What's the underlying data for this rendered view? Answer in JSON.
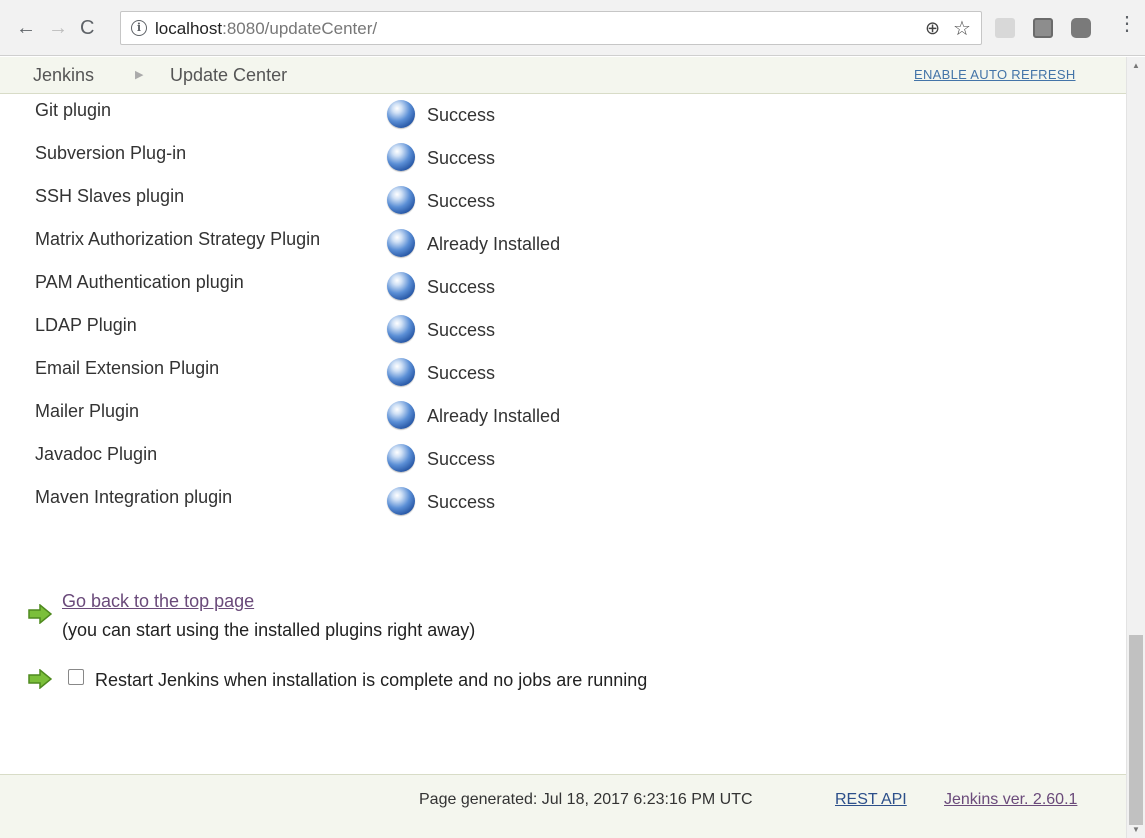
{
  "browser": {
    "back_icon": "back-arrow-icon",
    "forward_icon": "forward-arrow-icon",
    "reload_icon": "reload-icon",
    "url_host": "localhost",
    "url_rest": ":8080/updateCenter/"
  },
  "header": {
    "breadcrumb_home": "Jenkins",
    "breadcrumb_current": "Update Center",
    "auto_refresh_link": "ENABLE AUTO REFRESH"
  },
  "plugins": [
    {
      "name": "Git plugin",
      "status": "Success"
    },
    {
      "name": "Subversion Plug-in",
      "status": "Success"
    },
    {
      "name": "SSH Slaves plugin",
      "status": "Success"
    },
    {
      "name": "Matrix Authorization Strategy Plugin",
      "status": "Already Installed"
    },
    {
      "name": "PAM Authentication plugin",
      "status": "Success"
    },
    {
      "name": "LDAP Plugin",
      "status": "Success"
    },
    {
      "name": "Email Extension Plugin",
      "status": "Success"
    },
    {
      "name": "Mailer Plugin",
      "status": "Already Installed"
    },
    {
      "name": "Javadoc Plugin",
      "status": "Success"
    },
    {
      "name": "Maven Integration plugin",
      "status": "Success"
    }
  ],
  "actions": {
    "go_back_link": "Go back to the top page",
    "go_back_note": "(you can start using the installed plugins right away)",
    "restart_label": "Restart Jenkins when installation is complete and no jobs are running",
    "restart_checked": false
  },
  "footer": {
    "page_generated": "Page generated: Jul 18, 2017 6:23:16 PM UTC",
    "rest_api": "REST API",
    "jenkins_version": "Jenkins ver. 2.60.1"
  }
}
